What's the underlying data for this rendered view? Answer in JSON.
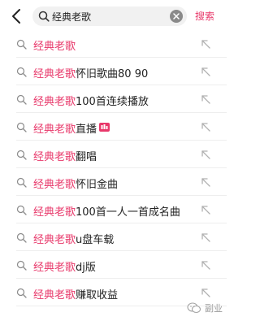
{
  "header": {
    "back_icon": "chevron-left-icon",
    "search": {
      "value": "经典老歌",
      "icon": "search-icon",
      "clear_icon": "clear-circle-icon"
    },
    "search_button_label": "搜索"
  },
  "suggestions": [
    {
      "keyword": "经典老歌",
      "suffix": "",
      "badge": false
    },
    {
      "keyword": "经典老歌",
      "suffix": "怀旧歌曲80 90",
      "badge": false
    },
    {
      "keyword": "经典老歌",
      "suffix": "100首连续播放",
      "badge": false
    },
    {
      "keyword": "经典老歌",
      "suffix": "直播",
      "badge": true
    },
    {
      "keyword": "经典老歌",
      "suffix": "翻唱",
      "badge": false
    },
    {
      "keyword": "经典老歌",
      "suffix": "怀旧金曲",
      "badge": false
    },
    {
      "keyword": "经典老歌",
      "suffix": "100首一人一首成名曲",
      "badge": false
    },
    {
      "keyword": "经典老歌",
      "suffix": "u盘车载",
      "badge": false
    },
    {
      "keyword": "经典老歌",
      "suffix": "dj版",
      "badge": false
    },
    {
      "keyword": "经典老歌",
      "suffix": "赚取收益",
      "badge": false
    }
  ],
  "watermark": {
    "text": "副业",
    "icon": "wechat-logo-icon"
  },
  "colors": {
    "accent": "#e8386a",
    "text": "#222222",
    "muted": "#9b9b9b",
    "search_bg": "#f1f1f1"
  }
}
